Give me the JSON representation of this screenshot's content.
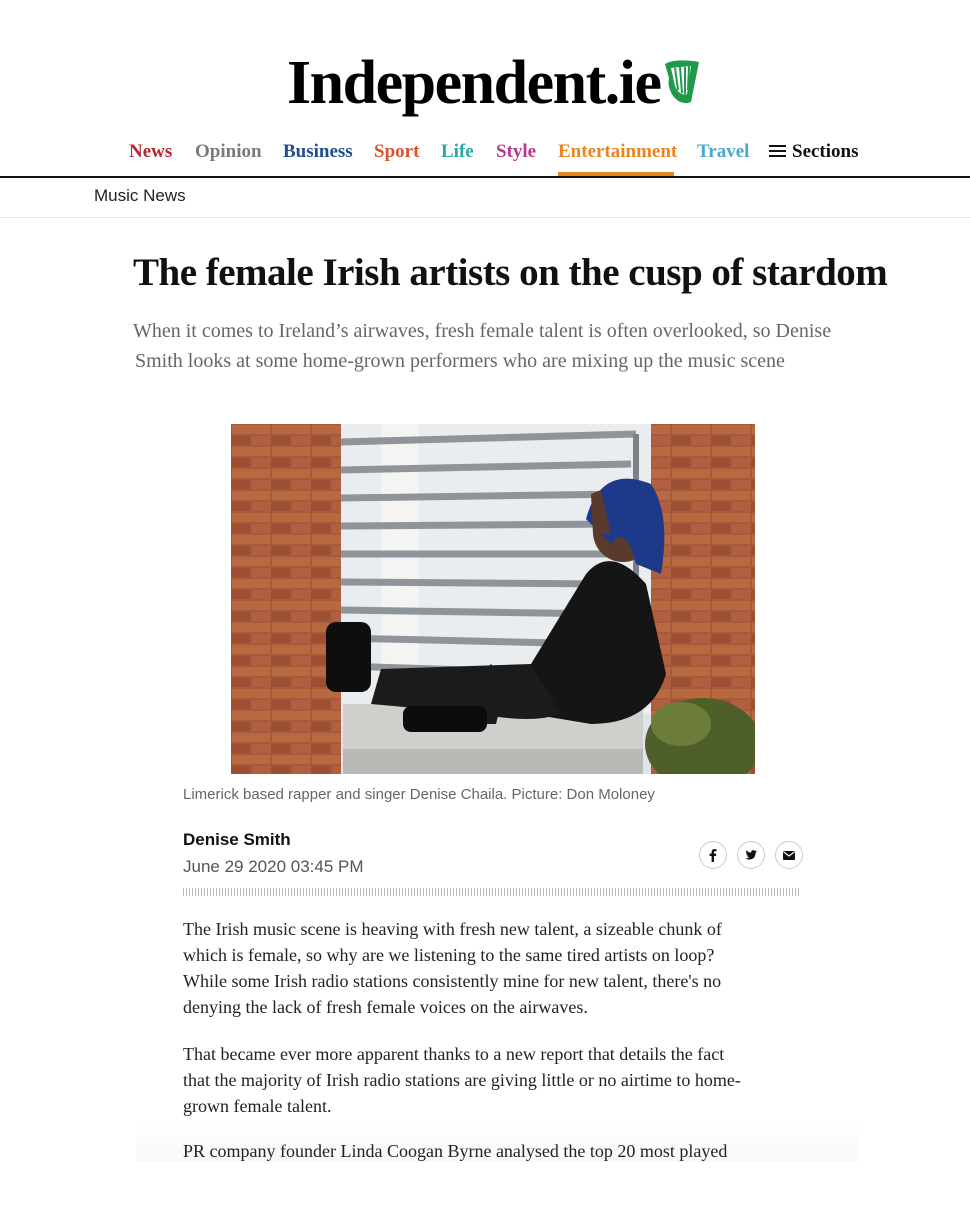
{
  "brand": {
    "logo_text": "Independent.ie"
  },
  "nav": {
    "items": [
      {
        "label": "News",
        "color": "#b5272d"
      },
      {
        "label": "Opinion",
        "color": "#7a7a7a"
      },
      {
        "label": "Business",
        "color": "#1f4e8c"
      },
      {
        "label": "Sport",
        "color": "#d9532b"
      },
      {
        "label": "Life",
        "color": "#2aa6a6"
      },
      {
        "label": "Style",
        "color": "#b7388a"
      },
      {
        "label": "Entertainment",
        "color": "#e8851e"
      },
      {
        "label": "Travel",
        "color": "#4aa8d0"
      }
    ],
    "sections_label": "Sections",
    "active": "Entertainment"
  },
  "breadcrumb": "Music News",
  "article": {
    "headline": "The female Irish artists on the cusp of stardom",
    "standfirst_line1": "When it comes to Ireland’s airwaves, fresh female talent is often overlooked, so Denise",
    "standfirst_line2": "Smith looks at some  home-grown performers who are mixing up the music scene",
    "caption": "Limerick based rapper and singer Denise Chaila. Picture: Don Moloney",
    "author": "Denise Smith",
    "date": "June 29 2020 03:45 PM",
    "paragraphs": [
      [
        "The Irish music scene is heaving with fresh new talent, a sizeable chunk of",
        "which is female, so why are we listening to the same tired artists on loop?",
        "While some Irish radio stations consistently mine for new talent, there's no",
        "denying the lack of fresh female voices on the airwaves."
      ],
      [
        "That became ever more apparent thanks to a new report that details the fact",
        "that the majority of Irish radio stations are giving little or no airtime to home-",
        "grown female talent."
      ],
      [
        "PR company founder Linda Coogan Byrne analysed the top 20 most played"
      ]
    ]
  },
  "share_icons": [
    "facebook-icon",
    "twitter-icon",
    "email-icon"
  ],
  "colors": {
    "accent": "#e8851e",
    "text": "#111111",
    "muted": "#666666"
  }
}
